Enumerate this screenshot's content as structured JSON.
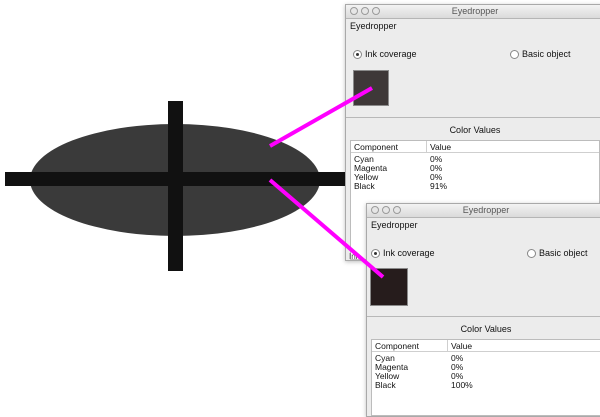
{
  "colors": {
    "ellipse": "#3a3a3a",
    "crosshair": "#111111",
    "leader_line": "#ff00ff",
    "swatch_top": "#3e3838",
    "swatch_bottom": "#261c1c"
  },
  "icons": [
    "crosshair-icon",
    "traffic-light-icon",
    "radio-icon"
  ],
  "window_back": {
    "title": "Eyedropper",
    "subtitle": "Eyedropper",
    "radio_ink": "Ink coverage",
    "radio_basic": "Basic object",
    "color_values": "Color Values",
    "col_component": "Component",
    "col_value": "Value",
    "rows": [
      {
        "component": "Cyan",
        "value": "0%"
      },
      {
        "component": "Magenta",
        "value": "0%"
      },
      {
        "component": "Yellow",
        "value": "0%"
      },
      {
        "component": "Black",
        "value": "91%"
      }
    ],
    "partial_text": "Ink"
  },
  "window_front": {
    "title": "Eyedropper",
    "subtitle": "Eyedropper",
    "radio_ink": "Ink coverage",
    "radio_basic": "Basic object",
    "color_values": "Color Values",
    "col_component": "Component",
    "col_value": "Value",
    "rows": [
      {
        "component": "Cyan",
        "value": "0%"
      },
      {
        "component": "Magenta",
        "value": "0%"
      },
      {
        "component": "Yellow",
        "value": "0%"
      },
      {
        "component": "Black",
        "value": "100%"
      }
    ]
  }
}
